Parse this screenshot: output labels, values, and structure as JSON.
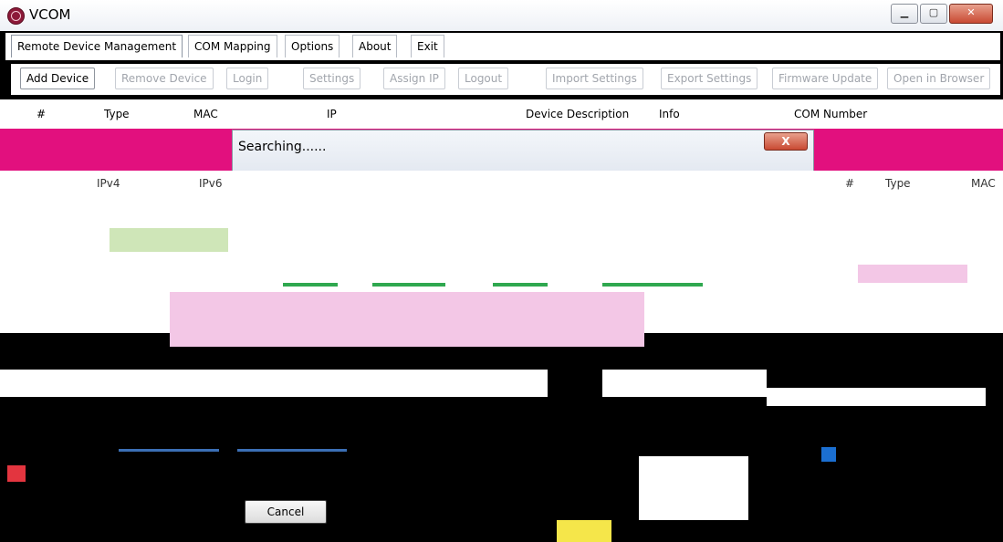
{
  "window": {
    "title": "VCOM",
    "controls": {
      "minimize": "▁",
      "maximize": "▢",
      "close": "✕"
    }
  },
  "menu": {
    "items": [
      {
        "label": "Remote Device Management",
        "active": true
      },
      {
        "label": "COM Mapping"
      },
      {
        "label": "Options"
      },
      {
        "label": "About"
      },
      {
        "label": "Exit"
      }
    ]
  },
  "toolbar": {
    "buttons": [
      {
        "label": "Add Device",
        "enabled": true
      },
      {
        "label": "Remove Device",
        "enabled": false
      },
      {
        "label": "Login",
        "enabled": false
      },
      {
        "label": "Settings",
        "enabled": false
      },
      {
        "label": "Assign IP",
        "enabled": false
      },
      {
        "label": "Logout",
        "enabled": false
      },
      {
        "label": "Import Settings",
        "enabled": false
      },
      {
        "label": "Export Settings",
        "enabled": false
      },
      {
        "label": "Firmware Update",
        "enabled": false
      },
      {
        "label": "Open in Browser",
        "enabled": false
      }
    ]
  },
  "grid": {
    "columns": [
      "#",
      "Type",
      "MAC",
      "IP",
      "Device Description",
      "Info",
      "COM Number"
    ]
  },
  "dialog": {
    "title": "Searching......",
    "close_label": "X",
    "columns": [
      "IPv4",
      "IPv6",
      "#",
      "Type",
      "MAC"
    ],
    "cancel_label": "Cancel"
  },
  "colors": {
    "accent_magenta": "#e2107e",
    "background_black": "#000000"
  }
}
